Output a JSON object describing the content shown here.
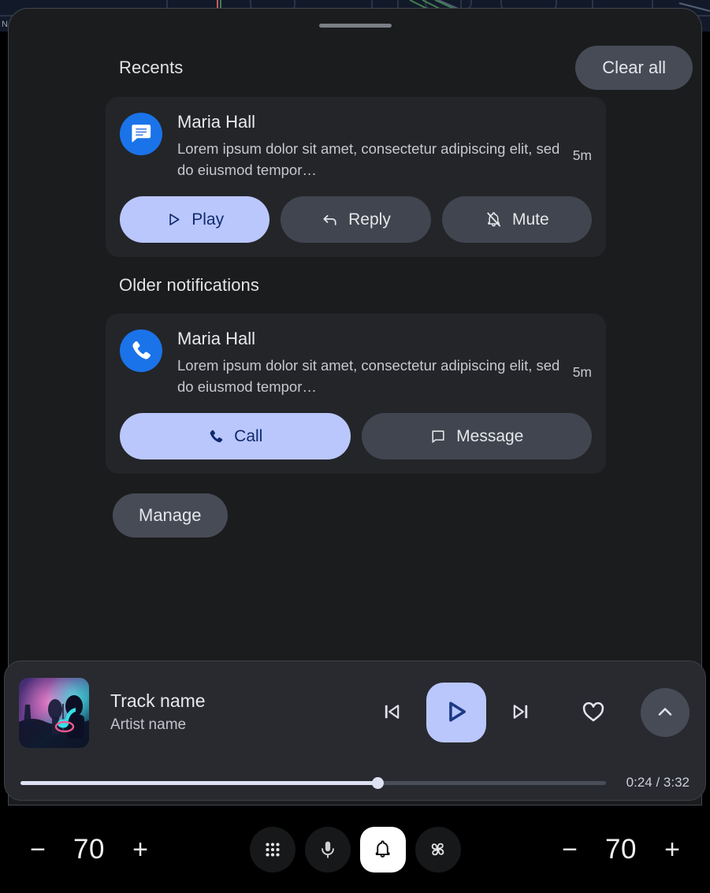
{
  "panel": {
    "drag_handle": "drag-handle",
    "sections": [
      {
        "title": "Recents",
        "action_label": "Clear all"
      },
      {
        "title": "Older notifications",
        "action_label": ""
      }
    ],
    "manage_label": "Manage"
  },
  "notifications": [
    {
      "app_icon": "messages-icon",
      "sender": "Maria Hall",
      "body": "Lorem ipsum dolor sit amet, consectetur adipiscing elit, sed do eiusmod tempor…",
      "time": "5m",
      "actions": [
        {
          "label": "Play",
          "icon": "play-icon",
          "style": "primary"
        },
        {
          "label": "Reply",
          "icon": "reply-icon",
          "style": "secondary"
        },
        {
          "label": "Mute",
          "icon": "bell-slash-icon",
          "style": "secondary"
        }
      ]
    },
    {
      "app_icon": "phone-icon",
      "sender": "Maria Hall",
      "body": "Lorem ipsum dolor sit amet, consectetur adipiscing elit, sed do eiusmod tempor…",
      "time": "5m",
      "actions": [
        {
          "label": "Call",
          "icon": "phone-icon",
          "style": "primary"
        },
        {
          "label": "Message",
          "icon": "chat-bubble-icon",
          "style": "secondary"
        }
      ]
    }
  ],
  "media": {
    "album_art": "concert-photo-thumbnail",
    "track_name": "Track name",
    "artist_name": "Artist name",
    "time_label": "0:24 / 3:32",
    "elapsed": "0:24",
    "duration": "3:32",
    "progress_percent": 61,
    "controls": {
      "previous": "skip-previous-icon",
      "play": "play-icon",
      "next": "skip-next-icon",
      "favorite": "heart-outline-icon",
      "expand": "chevron-up-icon"
    }
  },
  "system_bar": {
    "climate_left": {
      "decrease": "−",
      "value": "70",
      "increase": "+"
    },
    "climate_right": {
      "decrease": "−",
      "value": "70",
      "increase": "+"
    },
    "nav_items": [
      {
        "name": "apps",
        "icon": "grid-dots-icon",
        "active": false
      },
      {
        "name": "assistant",
        "icon": "microphone-icon",
        "active": false
      },
      {
        "name": "notifications",
        "icon": "bell-icon",
        "active": true
      },
      {
        "name": "climate",
        "icon": "fan-icon",
        "active": false
      }
    ]
  },
  "colors": {
    "panel_bg": "#1b1c1e",
    "card_bg": "#232529",
    "accent_light": "#bac7fc",
    "accent_dark_text": "#102a6e",
    "secondary_button": "#41454f",
    "app_blue": "#1a73e8",
    "text_primary": "#e8e9ed",
    "text_secondary": "#c6c8cf",
    "system_bar_bg": "#000000"
  }
}
